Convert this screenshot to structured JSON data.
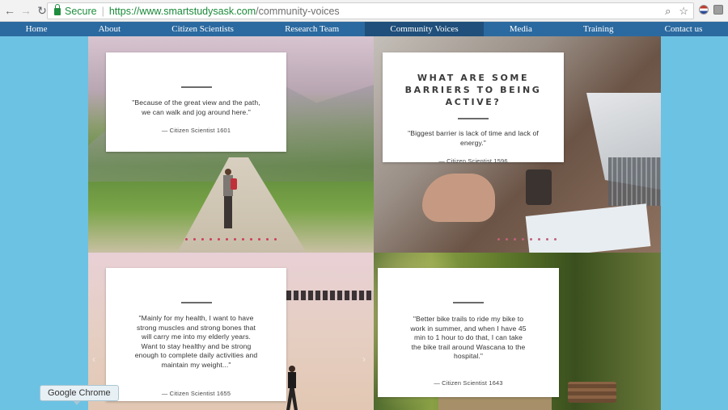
{
  "browser": {
    "secure_label": "Secure",
    "url_host": "https://www.smartstudysask.com",
    "url_path": "/community-voices",
    "back_icon": "arrow-left-icon",
    "forward_icon": "arrow-right-icon",
    "reload_icon": "reload-icon",
    "zoom_icon": "magnifier-icon",
    "star_icon": "star-icon",
    "tooltip": "Google Chrome"
  },
  "nav": {
    "items": [
      "Home",
      "About",
      "Citizen Scientists",
      "Research Team",
      "Community Voices",
      "Media",
      "Training",
      "Contact us"
    ],
    "active": "Community Voices",
    "bar_color": "#2b6aa0",
    "active_color": "#1f4f7a"
  },
  "cards": [
    {
      "quote": "\"Because of the great view and the path, we can walk and jog around here.\"",
      "attribution": "— Citizen Scientist 1601"
    },
    {
      "heading": "WHAT ARE SOME BARRIERS TO BEING ACTIVE?",
      "quote": "\"Biggest barrier is lack of time and lack of energy.\"",
      "attribution": "— Citizen Scientist 1596"
    },
    {
      "quote": "\"Mainly for my health, I want to have strong muscles and strong bones that will carry me into my elderly years. Want to stay healthy and be strong enough to complete daily activities and maintain my weight...\"",
      "attribution": "— Citizen Scientist 1655"
    },
    {
      "quote": "\"Better bike trails to ride my bike to work in summer, and when I have 45 min to 1 hour to do that, I can take the bike trail around Wascana to the hospital.\"",
      "attribution": "— Citizen Scientist 1643"
    }
  ],
  "theme": {
    "page_background": "#6cc2e3",
    "slider_dot_color": "#cc3d5f"
  }
}
